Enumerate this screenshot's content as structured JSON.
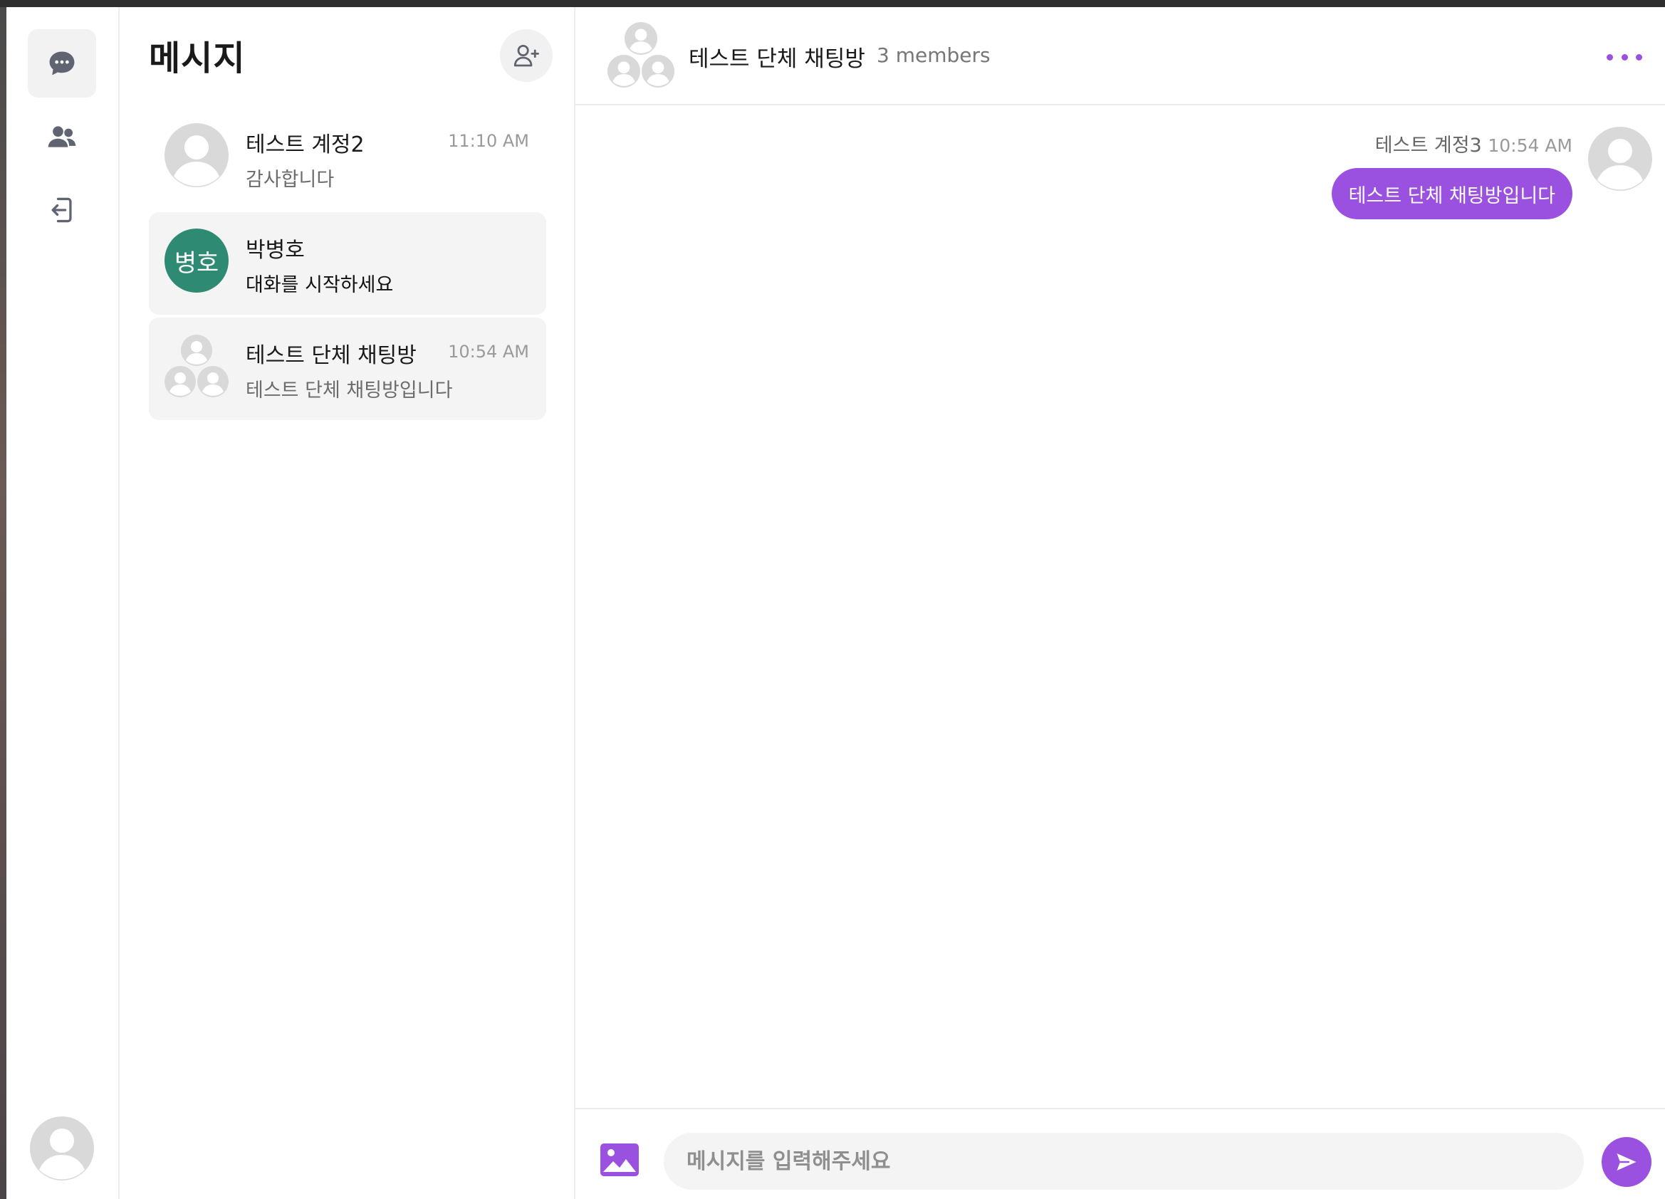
{
  "sidebar": {
    "icons": [
      "chat-bubble-icon",
      "users-icon",
      "logout-icon",
      "profile-avatar"
    ],
    "accent_color": "#9b51e0"
  },
  "conversation_list": {
    "title": "메시지",
    "new_chat_icon": "user-plus-icon",
    "items": [
      {
        "name": "테스트 계정2",
        "time": "11:10 AM",
        "preview": "감사합니다",
        "avatar": "default-avatar"
      },
      {
        "name": "박병호",
        "time": "",
        "preview": "대화를 시작하세요",
        "avatar_initials": "병호",
        "avatar_color": "#2e8a72"
      },
      {
        "name": "테스트 단체 채팅방",
        "time": "10:54 AM",
        "preview": "테스트 단체 채팅방입니다",
        "avatar": "group-avatar"
      }
    ]
  },
  "chat": {
    "title": "테스트 단체 채팅방",
    "members": "3 members",
    "messages": [
      {
        "sender": "테스트 계정3",
        "time": "10:54 AM",
        "text": "테스트 단체 채팅방입니다",
        "bubble_color": "#9b51e0"
      }
    ],
    "composer": {
      "placeholder": "메시지를 입력해주세요"
    }
  }
}
